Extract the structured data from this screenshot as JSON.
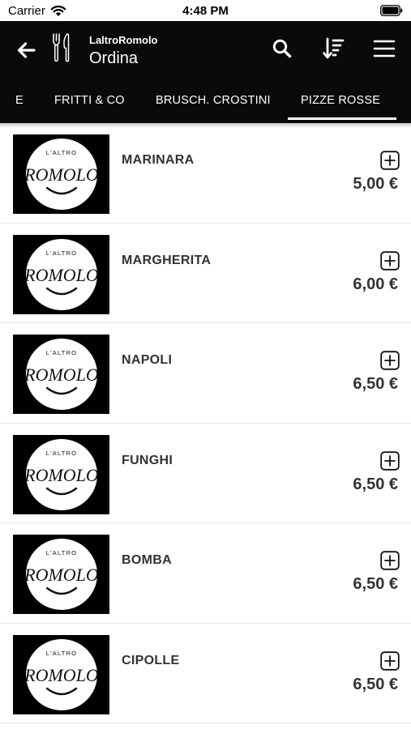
{
  "status_bar": {
    "carrier": "Carrier",
    "time": "4:48 PM"
  },
  "header": {
    "restaurant_name": "LaltroRomolo",
    "title": "Ordina"
  },
  "tabs": [
    {
      "label": "E",
      "active": false
    },
    {
      "label": "FRITTI & CO",
      "active": false
    },
    {
      "label": "BRUSCH. CROSTINI",
      "active": false
    },
    {
      "label": "PIZZE ROSSE",
      "active": true
    }
  ],
  "logo": {
    "small_text": "L'ALTRO",
    "big_text": "ROMOLO"
  },
  "products": [
    {
      "name": "MARINARA",
      "price": "5,00 €"
    },
    {
      "name": "MARGHERITA",
      "price": "6,00 €"
    },
    {
      "name": "NAPOLI",
      "price": "6,50 €"
    },
    {
      "name": "FUNGHI",
      "price": "6,50 €"
    },
    {
      "name": "BOMBA",
      "price": "6,50 €"
    },
    {
      "name": "CIPOLLE",
      "price": "6,50 €"
    }
  ],
  "colors": {
    "header_bg": "#0a0a0a",
    "text_dark": "#333333",
    "divider": "#e6e6e6"
  }
}
